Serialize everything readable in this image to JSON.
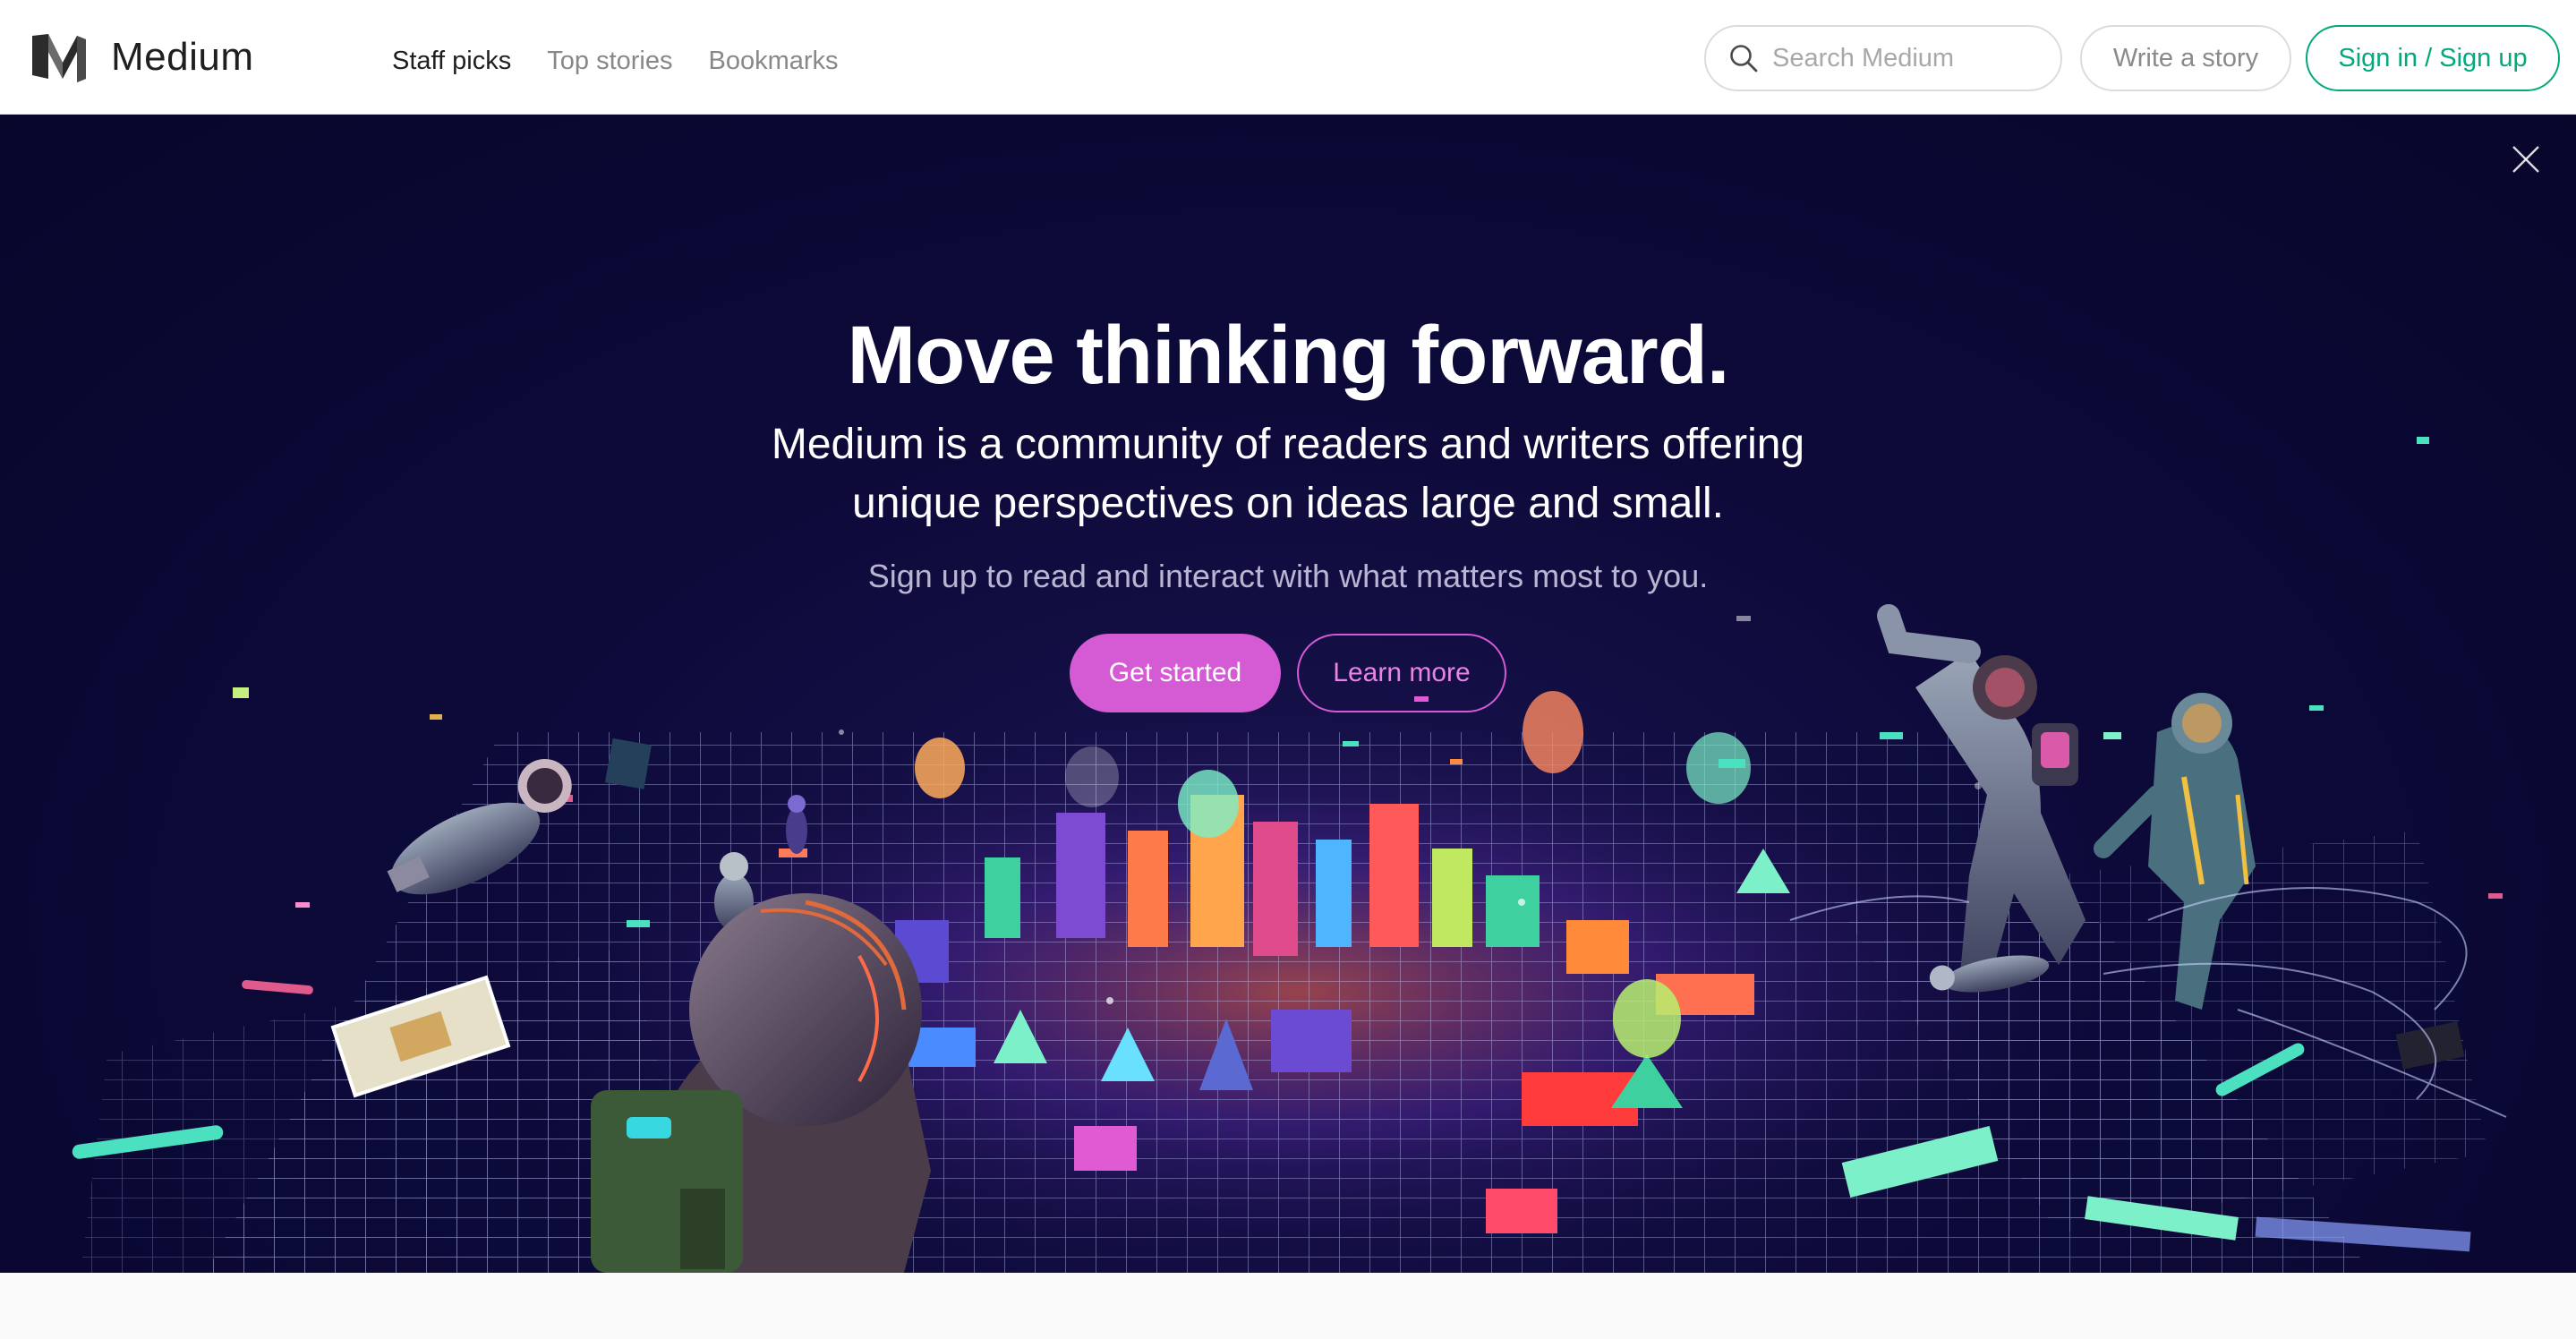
{
  "brand": {
    "name": "Medium",
    "logo_icon": "medium-m-logo-icon"
  },
  "nav": {
    "links": [
      {
        "label": "Staff picks",
        "active": true
      },
      {
        "label": "Top stories",
        "active": false
      },
      {
        "label": "Bookmarks",
        "active": false
      }
    ]
  },
  "search": {
    "placeholder": "Search Medium",
    "value": "",
    "icon": "search-icon"
  },
  "actions": {
    "write_label": "Write a story",
    "sign_label": "Sign in / Sign up"
  },
  "hero": {
    "title": "Move thinking forward.",
    "subtitle": "Medium is a community of readers and writers offering unique perspectives on ideas large and small.",
    "cta_text": "Sign up to read and interact with what matters most to you.",
    "primary_button": "Get started",
    "secondary_button": "Learn more",
    "close_icon": "close-icon",
    "illustration": "floating-astronauts-neon-city-illustration"
  },
  "colors": {
    "accent_green": "#03a87c",
    "accent_pink": "#d55bd4",
    "hero_background": "#0d0a3a",
    "navbar_background": "#ffffff"
  }
}
